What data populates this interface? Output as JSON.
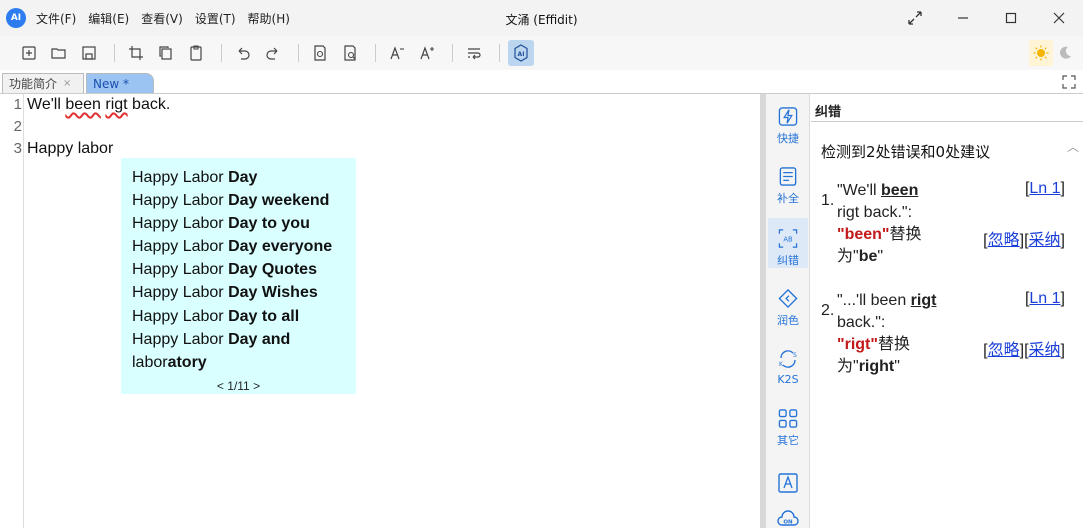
{
  "app": {
    "logo_text": "AI",
    "title": "文涌 (Effidit)"
  },
  "menu": [
    "文件(F)",
    "编辑(E)",
    "查看(V)",
    "设置(T)",
    "帮助(H)"
  ],
  "tabs": [
    {
      "label": "功能简介",
      "close": "×"
    },
    {
      "label": "New *"
    }
  ],
  "editor": {
    "line_numbers": [
      "1",
      "2",
      "3"
    ],
    "line1": {
      "pre": "We'll ",
      "err1": "been",
      "mid": " ",
      "err2": "rigt",
      "post": " back."
    },
    "line3": "Happy labor"
  },
  "popup": {
    "suggestions": [
      {
        "normal": "Happy Labor ",
        "bold": "Day"
      },
      {
        "normal": "Happy Labor ",
        "bold": "Day weekend"
      },
      {
        "normal": "Happy Labor ",
        "bold": "Day to you"
      },
      {
        "normal": "Happy Labor ",
        "bold": "Day everyone"
      },
      {
        "normal": "Happy Labor ",
        "bold": "Day Quotes"
      },
      {
        "normal": "Happy Labor ",
        "bold": "Day Wishes"
      },
      {
        "normal": "Happy Labor ",
        "bold": "Day to all"
      },
      {
        "normal": "Happy Labor ",
        "bold": "Day and"
      },
      {
        "normal": "labor",
        "bold": "atory"
      }
    ],
    "pager": "< 1/11 >"
  },
  "side_tools": [
    {
      "label": "快捷",
      "icon": "lightning-icon"
    },
    {
      "label": "补全",
      "icon": "complete-icon"
    },
    {
      "label": "纠错",
      "icon": "correct-icon"
    },
    {
      "label": "润色",
      "icon": "polish-icon"
    },
    {
      "label": "K2S",
      "icon": "k2s-icon"
    },
    {
      "label": "其它",
      "icon": "grid-icon"
    },
    {
      "label": "",
      "icon": "text-a-icon"
    },
    {
      "label": "",
      "icon": "cloud-on-icon"
    }
  ],
  "panel": {
    "title": "纠错",
    "summary": "检测到2处错误和0处建议",
    "items": [
      {
        "num": "1.",
        "quote_pre": "\"We'll ",
        "quote_word": "been",
        "quote_post": "rigt back.\":",
        "replace_from": "\"been\"",
        "replace_mid": "替换",
        "replace_to_pre": "为\"",
        "replace_to": "be",
        "replace_to_post": "\"",
        "ln_ref": "Ln 1",
        "ignore": "忽略",
        "accept": "采纳"
      },
      {
        "num": "2.",
        "quote_pre": "\"...'ll been ",
        "quote_word": "rigt",
        "quote_post": "back.\":",
        "replace_from": "\"rigt\"",
        "replace_mid": "替换",
        "replace_to_pre": "为\"",
        "replace_to": "right",
        "replace_to_post": "\"",
        "ln_ref": "Ln 1",
        "ignore": "忽略",
        "accept": "采纳"
      }
    ]
  },
  "colors": {
    "accent": "#2473d8",
    "error": "#c21a1a",
    "popup_bg": "#d9ffff",
    "link": "#1a3fd9"
  }
}
